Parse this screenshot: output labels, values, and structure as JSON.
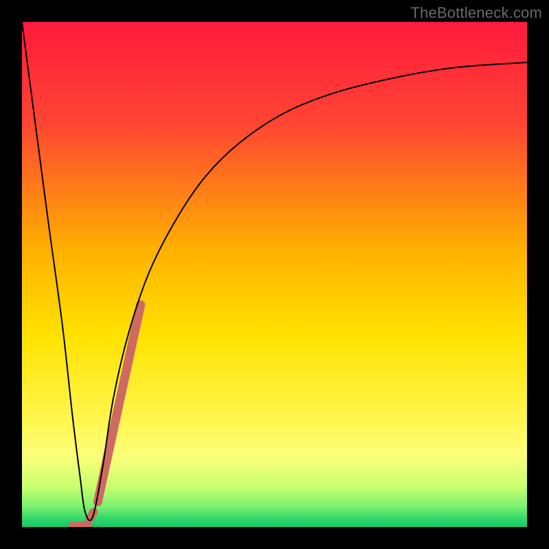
{
  "watermark": "TheBottleneck.com",
  "chart_data": {
    "type": "line",
    "title": "",
    "xlabel": "",
    "ylabel": "",
    "xlim": [
      0,
      100
    ],
    "ylim": [
      0,
      100
    ],
    "gradient_stops": [
      {
        "offset": 0,
        "color": "#ff1a3c"
      },
      {
        "offset": 0.2,
        "color": "#ff4433"
      },
      {
        "offset": 0.45,
        "color": "#ffb000"
      },
      {
        "offset": 0.62,
        "color": "#ffe200"
      },
      {
        "offset": 0.78,
        "color": "#fff54a"
      },
      {
        "offset": 0.86,
        "color": "#fbff7a"
      },
      {
        "offset": 0.92,
        "color": "#c9ff6e"
      },
      {
        "offset": 0.96,
        "color": "#7af06e"
      },
      {
        "offset": 0.985,
        "color": "#2fd56a"
      },
      {
        "offset": 1.0,
        "color": "#15c768"
      }
    ],
    "series": [
      {
        "name": "bottleneck-curve",
        "x": [
          0,
          5,
          8,
          10,
          11.5,
          12.5,
          14,
          16,
          18,
          21,
          25,
          30,
          36,
          43,
          52,
          62,
          74,
          86,
          100
        ],
        "values": [
          100,
          62,
          40,
          22,
          10,
          3,
          2,
          12,
          25,
          38,
          50,
          60,
          69,
          76,
          82,
          86,
          89,
          91,
          92
        ]
      }
    ],
    "markers": [
      {
        "name": "highlight-line",
        "x0": 15.0,
        "y0": 5,
        "x1": 23.5,
        "y1": 44,
        "width": 13,
        "color": "#cd6a62",
        "cap": "round"
      },
      {
        "name": "highlight-dot",
        "x0": 13.3,
        "y0": 1.5,
        "x1": 14.2,
        "y1": 3.0,
        "width": 12,
        "color": "#cd6a62",
        "cap": "round"
      },
      {
        "name": "highlight-base",
        "x0": 10.0,
        "y0": 0.2,
        "x1": 13.0,
        "y1": 0.4,
        "width": 12,
        "color": "#cd6a62",
        "cap": "round"
      }
    ]
  }
}
